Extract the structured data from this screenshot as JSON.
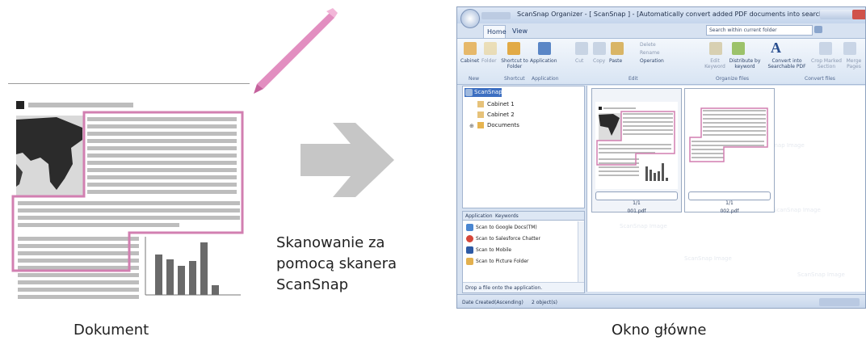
{
  "captions": {
    "left": "Dokument",
    "middle": [
      "Skanowanie za",
      "pomocą skanera",
      "ScanSnap"
    ],
    "right": "Okno główne"
  },
  "window": {
    "title": "ScanSnap Organizer - [ ScanSnap ] - [Automatically convert added PDF documents into searchable ones]",
    "tabs": [
      "Home",
      "View"
    ],
    "search_placeholder": "Search within current folder",
    "ribbon_buttons": [
      "Cabinet",
      "Folder",
      "Shortcut to Folder",
      "Application",
      "Cut",
      "Copy",
      "Paste",
      "Delete",
      "Rename",
      "Operation",
      "Edit Keyword",
      "Distribute by keyword",
      "Convert into Searchable PDF",
      "Crop Marked Section",
      "Merge Pages"
    ],
    "ribbon_groups": [
      "New",
      "Shortcut",
      "Application",
      "Edit",
      "Organize files",
      "Convert files"
    ],
    "tree": [
      "ScanSnap",
      "Cabinet 1",
      "Cabinet 2",
      "Documents"
    ],
    "panel_tabs": [
      "Application",
      "Keywords"
    ],
    "apps": [
      "Scan to Google Docs(TM)",
      "Scan to Salesforce Chatter",
      "Scan to Mobile",
      "Scan to Picture Folder"
    ],
    "drop_hint": "Drop a file onto the application.",
    "files": [
      {
        "page": "1/1",
        "name": "001.pdf"
      },
      {
        "page": "1/1",
        "name": "002.pdf"
      }
    ],
    "watermark": "ScanSnap Image",
    "status": {
      "sort": "Date Created(Ascending)",
      "count": "2 object(s)"
    }
  },
  "colors": {
    "highlight": "#d27fb1",
    "arrow": "#c6c6c6",
    "pen": "#e28ec0",
    "text_lines": "#bdbdbd"
  }
}
